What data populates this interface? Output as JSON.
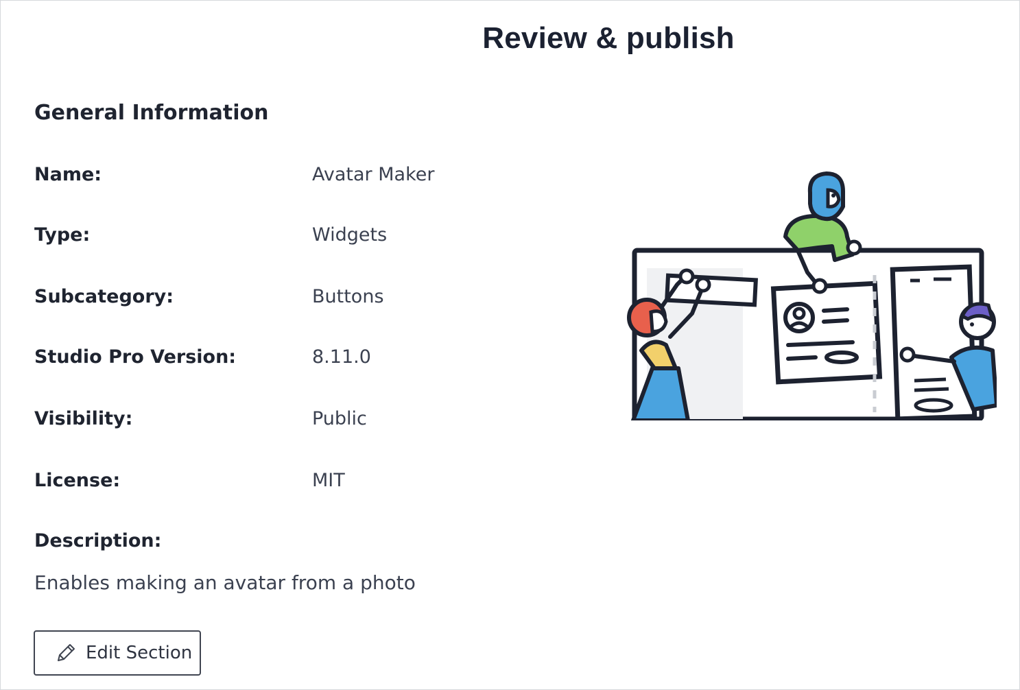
{
  "header": {
    "title": "Review & publish"
  },
  "general": {
    "section_title": "General Information",
    "fields": [
      {
        "label": "Name:",
        "value": "Avatar Maker"
      },
      {
        "label": "Type:",
        "value": "Widgets"
      },
      {
        "label": "Subcategory:",
        "value": "Buttons"
      },
      {
        "label": "Studio Pro Version:",
        "value": "8.11.0"
      },
      {
        "label": "Visibility:",
        "value": "Public"
      },
      {
        "label": "License:",
        "value": "MIT"
      }
    ],
    "description_label": "Description:",
    "description_value": "Enables making an avatar from a photo"
  },
  "actions": {
    "edit_label": "Edit Section",
    "edit_icon": "pencil-icon"
  },
  "illustration": {
    "icon": "team-collaboration-illustration"
  },
  "colors": {
    "text_dark": "#1f2430",
    "text_value": "#3b4150",
    "border": "#d6d8dc",
    "person_green": "#8fd16a",
    "person_blue": "#4aa3df",
    "person_yellow": "#f2d06b",
    "person_red": "#e8604c",
    "person_purple": "#6c5fc7"
  }
}
